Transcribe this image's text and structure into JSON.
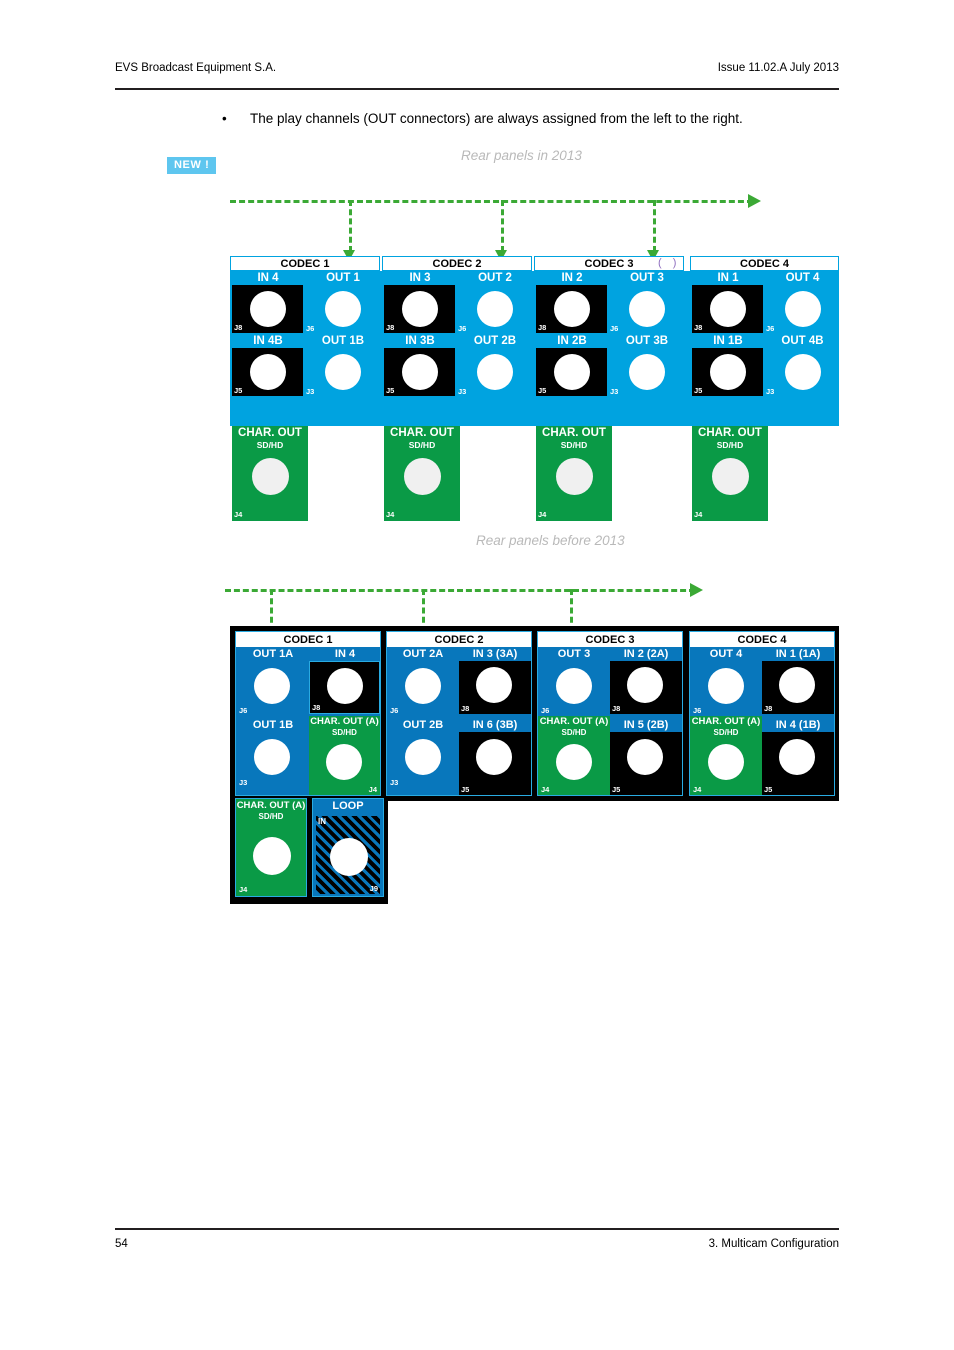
{
  "header": {
    "left": "EVS Broadcast Equipment S.A.",
    "right": "Issue 11.02.A July 2013"
  },
  "footer": {
    "page": "54",
    "section": "3. Multicam Configuration"
  },
  "bullet": {
    "marker": "•",
    "text": "The play channels (OUT connectors) are always assigned from the left to the right."
  },
  "badge": {
    "label": "NEW !"
  },
  "captions": {
    "top": "Rear panels in 2013",
    "bottom": "Rear panels before 2013"
  },
  "diagram_2013": {
    "caption": "Rear panels in 2013",
    "codecs": [
      {
        "title": "CODEC 1",
        "in_top": {
          "label": "IN 4",
          "jack": "J8"
        },
        "out_top": {
          "label": "OUT 1",
          "jack": "J6"
        },
        "in_bot": {
          "label": "IN 4B",
          "jack": "J5"
        },
        "out_bot": {
          "label": "OUT 1B",
          "jack": "J3"
        },
        "char_out": {
          "label": "CHAR. OUT",
          "sub": "SD/HD",
          "jack": "J4"
        }
      },
      {
        "title": "CODEC 2",
        "in_top": {
          "label": "IN 3",
          "jack": "J8"
        },
        "out_top": {
          "label": "OUT 2",
          "jack": "J6"
        },
        "in_bot": {
          "label": "IN 3B",
          "jack": "J5"
        },
        "out_bot": {
          "label": "OUT 2B",
          "jack": "J3"
        },
        "char_out": {
          "label": "CHAR. OUT",
          "sub": "SD/HD",
          "jack": "J4"
        }
      },
      {
        "title": "CODEC 3",
        "in_top": {
          "label": "IN 2",
          "jack": "J8"
        },
        "out_top": {
          "label": "OUT 3",
          "jack": "J6"
        },
        "in_bot": {
          "label": "IN 2B",
          "jack": "J5"
        },
        "out_bot": {
          "label": "OUT 3B",
          "jack": "J3"
        },
        "char_out": {
          "label": "CHAR. OUT",
          "sub": "SD/HD",
          "jack": "J4"
        }
      },
      {
        "title": "CODEC 4",
        "in_top": {
          "label": "IN 1",
          "jack": "J8"
        },
        "out_top": {
          "label": "OUT 4",
          "jack": "J6"
        },
        "in_bot": {
          "label": "IN 1B",
          "jack": "J5"
        },
        "out_bot": {
          "label": "OUT 4B",
          "jack": "J3"
        },
        "char_out": {
          "label": "CHAR. OUT",
          "sub": "SD/HD",
          "jack": "J4"
        }
      }
    ],
    "artifact_marks": "(  )",
    "arrow_targets": [
      "OUT 1",
      "OUT 2",
      "OUT 3"
    ]
  },
  "diagram_before_2013": {
    "caption": "Rear panels before 2013",
    "codecs": [
      {
        "title": "CODEC 1",
        "out_top": {
          "label": "OUT 1A",
          "jack": "J6"
        },
        "in_top": {
          "label": "IN 4",
          "jack": "J8"
        },
        "out_bot": {
          "label": "OUT 1B",
          "jack": "J3"
        },
        "in_bot": {
          "label": "CHAR. OUT (A)",
          "sub": "SD/HD",
          "jack": "J4",
          "type": "char"
        }
      },
      {
        "title": "CODEC 2",
        "out_top": {
          "label": "OUT 2A",
          "jack": "J6"
        },
        "in_top": {
          "label": "IN 3 (3A)",
          "jack": "J8"
        },
        "out_bot": {
          "label": "OUT 2B",
          "jack": "J3"
        },
        "in_bot": {
          "label": "IN 6 (3B)",
          "jack": "J5",
          "type": "in"
        }
      },
      {
        "title": "CODEC 3",
        "out_top": {
          "label": "OUT 3",
          "jack": "J6"
        },
        "in_top": {
          "label": "IN 2 (2A)",
          "jack": "J8"
        },
        "out_bot": {
          "label": "CHAR. OUT (A)",
          "sub": "SD/HD",
          "jack": "J4",
          "type": "char"
        },
        "in_bot": {
          "label": "IN 5 (2B)",
          "jack": "J5",
          "type": "in"
        }
      },
      {
        "title": "CODEC 4",
        "out_top": {
          "label": "OUT 4",
          "jack": "J6"
        },
        "in_top": {
          "label": "IN 1 (1A)",
          "jack": "J8"
        },
        "out_bot": {
          "label": "CHAR. OUT (A)",
          "sub": "SD/HD",
          "jack": "J4",
          "type": "char"
        },
        "in_bot": {
          "label": "IN 4 (1B)",
          "jack": "J5",
          "type": "in"
        }
      }
    ],
    "extra": {
      "char_out": {
        "label": "CHAR. OUT (A)",
        "sub": "SD/HD",
        "jack": "J4"
      },
      "loop": {
        "label": "LOOP",
        "sub": "IN",
        "jack": "J9"
      }
    },
    "arrow_targets": [
      "CODEC 1",
      "CODEC 2",
      "CODEC 3"
    ]
  },
  "colors": {
    "blue_2013": "#00a3e0",
    "blue_before": "#0877bc",
    "blue_border": "#29abe2",
    "green": "#0a9a46",
    "arrow_green": "#3ba935",
    "badge_bg": "#5ec6ef",
    "caption_grey": "#b9b9b9",
    "artifact_purple": "#8f6fbf"
  }
}
